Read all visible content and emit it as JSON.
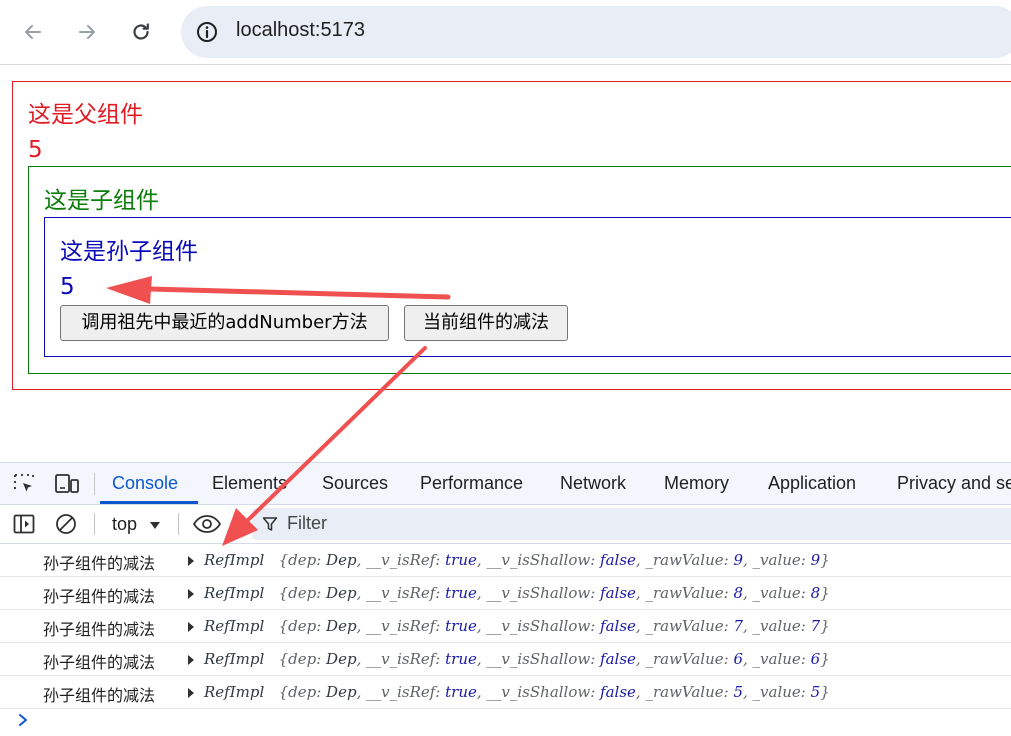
{
  "browser": {
    "url": "localhost:5173",
    "icons": {
      "back": "back-arrow-icon",
      "forward": "forward-arrow-icon",
      "reload": "reload-icon",
      "site_info": "site-info-icon"
    }
  },
  "page": {
    "parent": {
      "title": "这是父组件",
      "value": "5",
      "color": "#e01b24"
    },
    "child": {
      "title": "这是子组件",
      "color": "#0a7d0a"
    },
    "grandchild": {
      "title": "这是孙子组件",
      "value": "5",
      "color": "#0a0ab8",
      "buttons": {
        "call_ancestor": "调用祖先中最近的addNumber方法",
        "subtract": "当前组件的减法"
      }
    },
    "annotation_color": "#f05050"
  },
  "devtools": {
    "tabs": [
      "Console",
      "Elements",
      "Sources",
      "Performance",
      "Network",
      "Memory",
      "Application",
      "Privacy and se"
    ],
    "active_tab": "Console",
    "toolbar": {
      "context": "top",
      "filter_placeholder": "Filter"
    },
    "logs": [
      {
        "label": "孙子组件的减法",
        "class_name": "RefImpl",
        "dep": "Dep",
        "v_isRef": "true",
        "v_isShallow": "false",
        "rawValue": "9",
        "value": "9"
      },
      {
        "label": "孙子组件的减法",
        "class_name": "RefImpl",
        "dep": "Dep",
        "v_isRef": "true",
        "v_isShallow": "false",
        "rawValue": "8",
        "value": "8"
      },
      {
        "label": "孙子组件的减法",
        "class_name": "RefImpl",
        "dep": "Dep",
        "v_isRef": "true",
        "v_isShallow": "false",
        "rawValue": "7",
        "value": "7"
      },
      {
        "label": "孙子组件的减法",
        "class_name": "RefImpl",
        "dep": "Dep",
        "v_isRef": "true",
        "v_isShallow": "false",
        "rawValue": "6",
        "value": "6"
      },
      {
        "label": "孙子组件的减法",
        "class_name": "RefImpl",
        "dep": "Dep",
        "v_isRef": "true",
        "v_isShallow": "false",
        "rawValue": "5",
        "value": "5"
      }
    ],
    "prompt_symbol": "›"
  }
}
